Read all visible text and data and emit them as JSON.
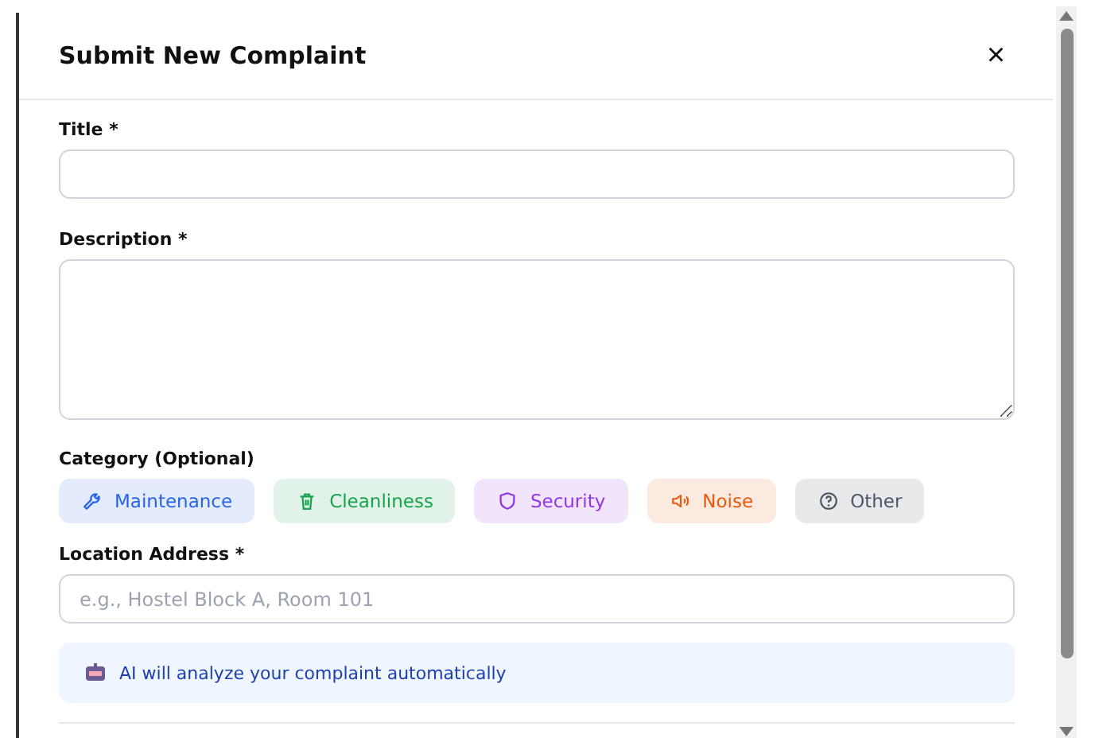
{
  "dialog": {
    "title": "Submit New Complaint",
    "close": "×"
  },
  "fields": [
    {
      "kind": "input",
      "label": "Title *"
    },
    {
      "kind": "textarea",
      "label": "Description *"
    }
  ],
  "category": {
    "label": "Category (Optional)",
    "options": [
      {
        "kind": "maintenance",
        "label": "Maintenance",
        "color": "#2563eb"
      },
      {
        "kind": "cleanliness",
        "label": "Cleanliness",
        "color": "#16a34a"
      },
      {
        "kind": "security",
        "label": "Security",
        "color": "#9333ea"
      },
      {
        "kind": "noise",
        "label": "Noise",
        "color": "#ea580c"
      },
      {
        "kind": "other",
        "label": "Other",
        "color": "#4b5563"
      }
    ]
  },
  "location": {
    "label": "Location Address *",
    "placeholder": "e.g., Hostel Block A, Room 101"
  },
  "ai_notice": {
    "text": "AI will analyze your complaint automatically"
  }
}
